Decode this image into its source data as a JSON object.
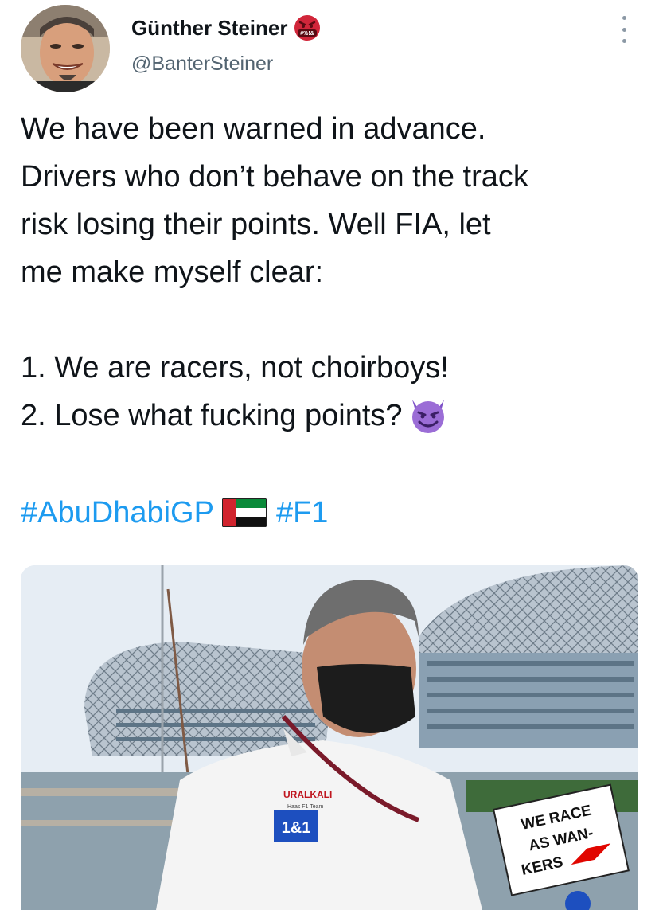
{
  "tweet": {
    "author": {
      "display_name": "Günther Steiner",
      "handle": "@BanterSteiner",
      "badge_icon": "angry-face-with-symbols-icon",
      "badge_text": "#%!&"
    },
    "menu_icon": "more-vertical-icon",
    "body_lines": [
      "We have been warned in advance.",
      "Drivers who don’t behave on the track",
      "risk losing their points. Well FIA, let",
      "me make myself clear:",
      "1. We are racers, not choirboys!",
      "2. Lose what fucking points?"
    ],
    "body_emoji": "smiling-devil-icon",
    "hashtags": [
      "#AbuDhabiGP",
      "#F1"
    ],
    "hashtag_flag": "uae-flag-icon",
    "media": {
      "sponsor_text": "URALKALI",
      "sponsor_small": "Haas F1 Team",
      "sponsor_box": "1&1",
      "sign_lines": [
        "WE RACE",
        "AS WAN-",
        "KERS"
      ],
      "colors": {
        "sky": "#e6edf4",
        "sign": "#ffffff",
        "sponsor_blue": "#1d4fbf",
        "f1_red": "#e10600"
      }
    }
  },
  "colors": {
    "text": "#0f1419",
    "muted": "#536471",
    "link": "#1d9bf0"
  }
}
